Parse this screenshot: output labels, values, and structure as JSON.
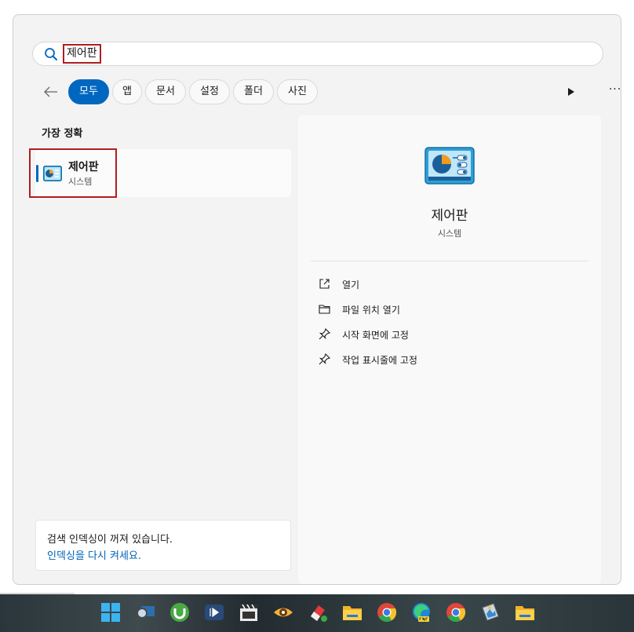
{
  "search": {
    "query": "제어판"
  },
  "filters": {
    "tabs": [
      {
        "label": "모두",
        "active": true
      },
      {
        "label": "앱",
        "active": false
      },
      {
        "label": "문서",
        "active": false
      },
      {
        "label": "설정",
        "active": false
      },
      {
        "label": "폴더",
        "active": false
      },
      {
        "label": "사진",
        "active": false
      }
    ],
    "more": "···"
  },
  "best_match": {
    "title": "가장 정확",
    "name": "제어판",
    "type": "시스템",
    "icon": "control-panel-icon"
  },
  "detail": {
    "name": "제어판",
    "type": "시스템",
    "actions": [
      {
        "label": "열기",
        "icon": "open-external-icon"
      },
      {
        "label": "파일 위치 열기",
        "icon": "folder-icon"
      },
      {
        "label": "시작 화면에 고정",
        "icon": "pin-icon"
      },
      {
        "label": "작업 표시줄에 고정",
        "icon": "pin-icon"
      }
    ]
  },
  "indexing": {
    "message": "검색 인덱싱이 꺼져 있습니다.",
    "link": "인덱싱을 다시 켜세요."
  },
  "taskbar": {
    "icons": [
      "windows-start-icon",
      "search-magnifier-icon",
      "utorrent-icon",
      "media-player-icon",
      "clapper-icon",
      "eye-app-icon",
      "eraser-app-icon",
      "file-explorer-icon",
      "chrome-icon",
      "edge-can-icon",
      "chrome-icon",
      "image-viewer-icon",
      "file-explorer-icon"
    ]
  },
  "colors": {
    "accent": "#0067c0",
    "highlight": "#b21e1e",
    "link": "#0062b8"
  }
}
